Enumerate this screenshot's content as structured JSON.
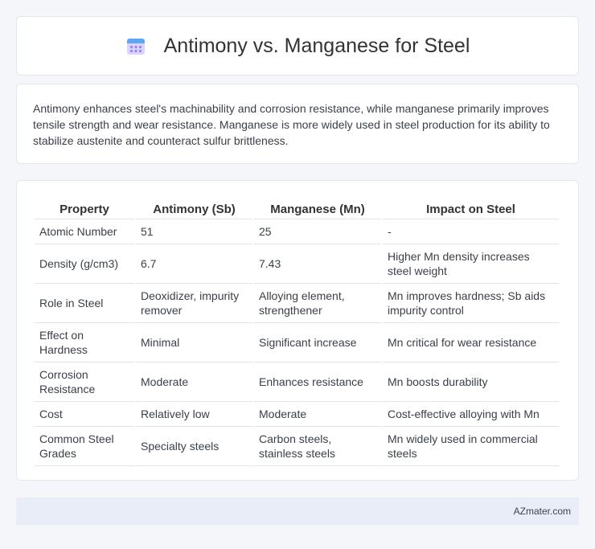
{
  "header": {
    "title": "Antimony vs. Manganese for Steel",
    "icon": "calendar-icon"
  },
  "intro": {
    "text": "Antimony enhances steel's machinability and corrosion resistance, while manganese primarily improves tensile strength and wear resistance. Manganese is more widely used in steel production for its ability to stabilize austenite and counteract sulfur brittleness."
  },
  "table": {
    "headers": [
      "Property",
      "Antimony (Sb)",
      "Manganese (Mn)",
      "Impact on Steel"
    ],
    "rows": [
      [
        "Atomic Number",
        "51",
        "25",
        "-"
      ],
      [
        "Density (g/cm3)",
        "6.7",
        "7.43",
        "Higher Mn density increases steel weight"
      ],
      [
        "Role in Steel",
        "Deoxidizer, impurity remover",
        "Alloying element, strengthener",
        "Mn improves hardness; Sb aids impurity control"
      ],
      [
        "Effect on Hardness",
        "Minimal",
        "Significant increase",
        "Mn critical for wear resistance"
      ],
      [
        "Corrosion Resistance",
        "Moderate",
        "Enhances resistance",
        "Mn boosts durability"
      ],
      [
        "Cost",
        "Relatively low",
        "Moderate",
        "Cost-effective alloying with Mn"
      ],
      [
        "Common Steel Grades",
        "Specialty steels",
        "Carbon steels, stainless steels",
        "Mn widely used in commercial steels"
      ]
    ]
  },
  "footer": {
    "brand": "AZmater.com"
  },
  "colors": {
    "background": "#f4f6fa",
    "card": "#ffffff",
    "footer": "#e8edf7",
    "icon_accent": "#7b6cf0"
  }
}
